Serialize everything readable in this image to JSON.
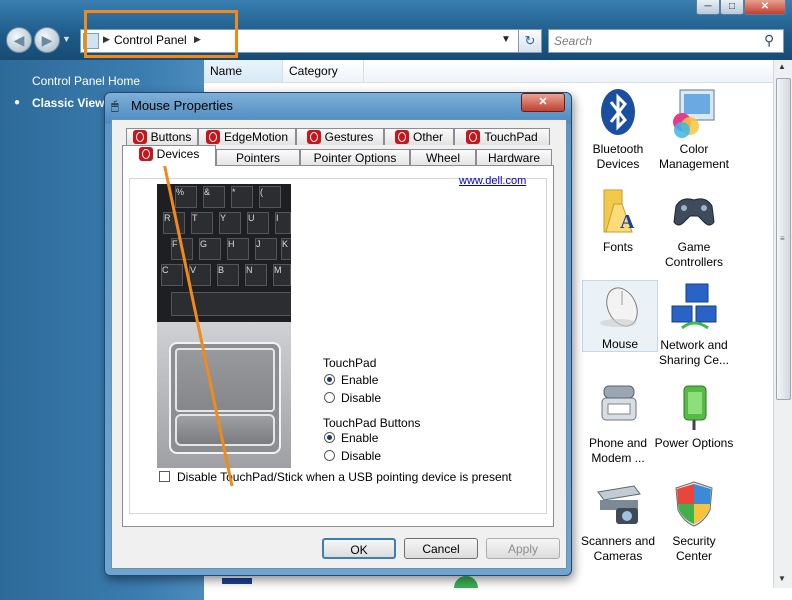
{
  "window": {
    "min": "─",
    "max": "□",
    "close": "✕"
  },
  "address": {
    "path": "Control Panel",
    "search_placeholder": "Search"
  },
  "sidebar": {
    "home": "Control Panel Home",
    "classic": "Classic View"
  },
  "columns": [
    "Name",
    "Category"
  ],
  "icons": [
    {
      "label": "Bluetooth Devices"
    },
    {
      "label": "Color Management"
    },
    {
      "label": "Fonts"
    },
    {
      "label": "Game Controllers"
    },
    {
      "label": "Mouse"
    },
    {
      "label": "Network and Sharing Ce..."
    },
    {
      "label": "Phone and Modem ..."
    },
    {
      "label": "Power Options"
    },
    {
      "label": "Scanners and Cameras"
    },
    {
      "label": "Security Center"
    }
  ],
  "dialog": {
    "title": "Mouse Properties",
    "close": "✕",
    "tabs_top": [
      "Buttons",
      "EdgeMotion",
      "Gestures",
      "Other",
      "TouchPad"
    ],
    "tabs_bottom": [
      "Devices",
      "Pointers",
      "Pointer Options",
      "Wheel",
      "Hardware"
    ],
    "link": "www.dell.com",
    "touchpad_label": "TouchPad",
    "enable": "Enable",
    "disable": "Disable",
    "buttons_label": "TouchPad Buttons",
    "disable_usb": "Disable TouchPad/Stick when a USB pointing device is present",
    "ok": "OK",
    "cancel": "Cancel",
    "apply": "Apply"
  },
  "keyboard_keys": [
    "%",
    "&",
    "*",
    "(",
    "R",
    "T",
    "Y",
    "U",
    "I",
    "F",
    "G",
    "H",
    "J",
    "K",
    "C",
    "V",
    "B",
    "N",
    "M"
  ],
  "colors": {
    "accent": "#f08a1a",
    "dell_red": "#c4161c"
  }
}
